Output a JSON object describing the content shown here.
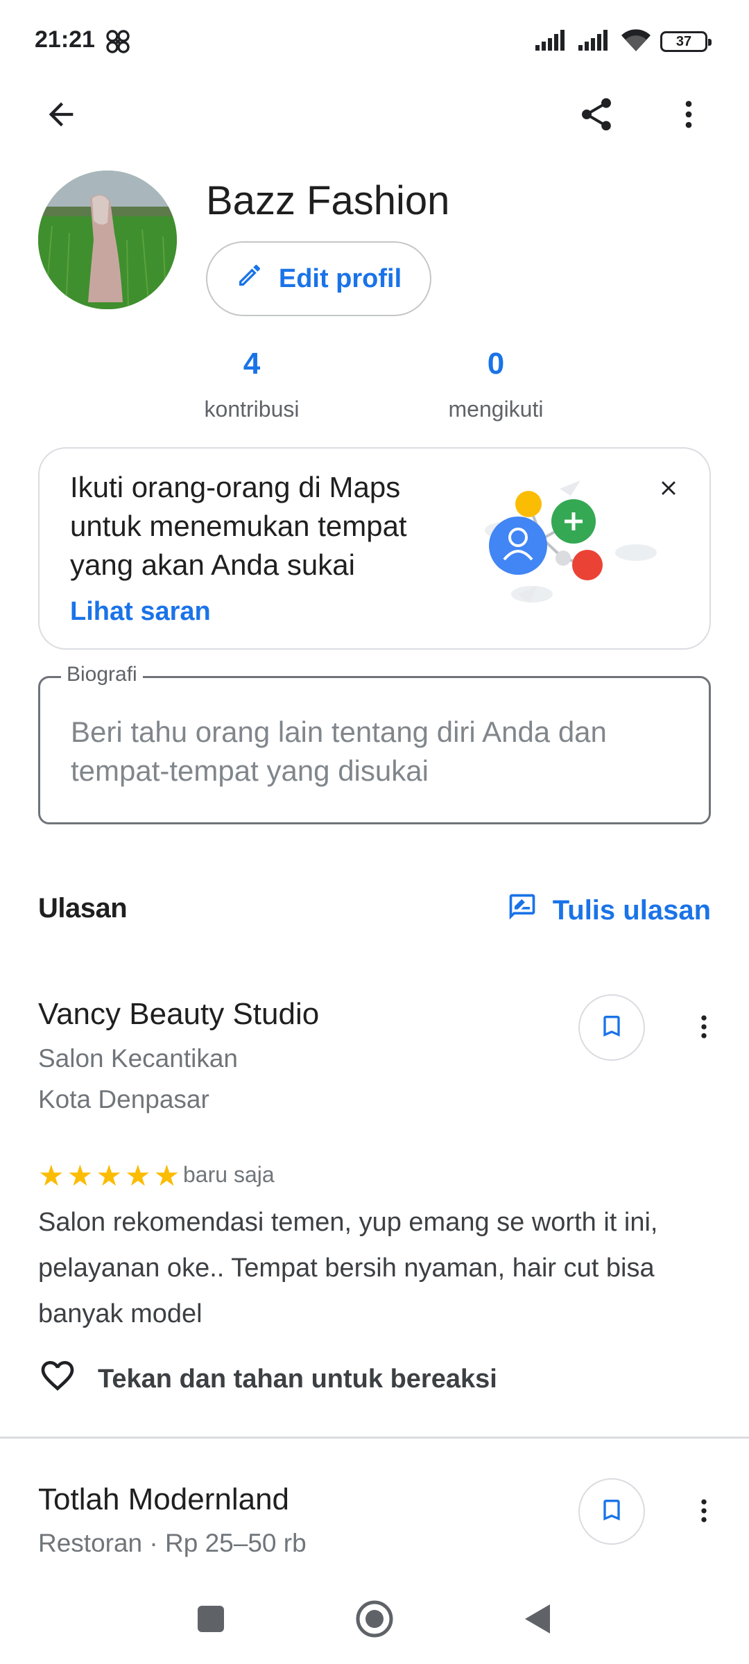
{
  "status_bar": {
    "time": "21:21",
    "battery": "37",
    "icons": [
      "fan-icon",
      "signal-icon",
      "signal-icon",
      "wifi-icon",
      "battery-icon"
    ]
  },
  "app_bar": {
    "icons": [
      "back-arrow-icon",
      "share-icon",
      "more-vert-icon"
    ]
  },
  "profile": {
    "name": "Bazz Fashion",
    "edit_label": "Edit profil",
    "stats": [
      {
        "value": "4",
        "label": "kontribusi"
      },
      {
        "value": "0",
        "label": "mengikuti"
      }
    ]
  },
  "suggest_card": {
    "text": "Ikuti orang-orang di Maps untuk menemukan tempat yang akan Anda sukai",
    "link": "Lihat saran"
  },
  "bio": {
    "label": "Biografi",
    "placeholder": "Beri tahu orang lain tentang diri Anda dan tempat-tempat yang disukai"
  },
  "reviews_section": {
    "title": "Ulasan",
    "write_label": "Tulis ulasan"
  },
  "reviews": [
    {
      "place": "Vancy Beauty Studio",
      "category": "Salon Kecantikan",
      "location": "Kota Denpasar",
      "rating": 5,
      "time": "baru saja",
      "text": "Salon rekomendasi temen, yup emang se worth it ini, pelayanan oke.. Tempat bersih nyaman, hair cut bisa banyak model",
      "react_label": "Tekan dan tahan untuk bereaksi"
    },
    {
      "place": "Totlah Modernland",
      "category": "Restoran · Rp 25–50 rb"
    }
  ],
  "colors": {
    "accent": "#1a73e8",
    "star": "#fbbc04",
    "text_secondary": "#70757a"
  }
}
